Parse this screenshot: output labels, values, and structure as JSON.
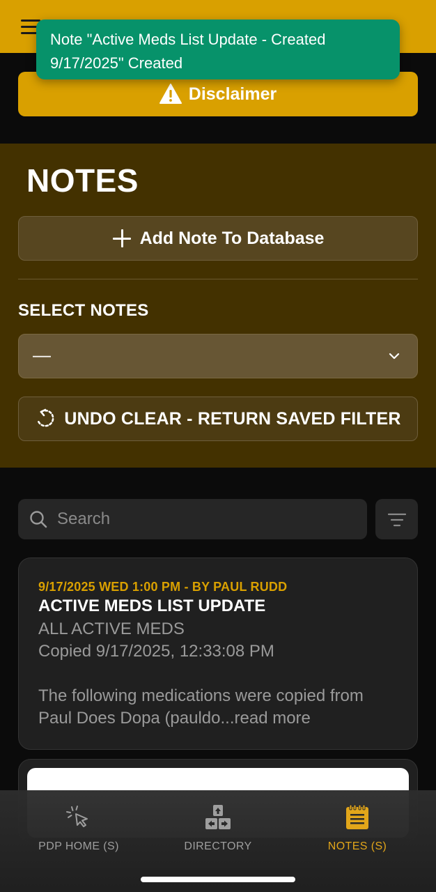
{
  "header": {
    "menu_icon": "hamburger-menu-icon",
    "toast": "Note \"Active Meds List Update - Created 9/17/2025\" Created"
  },
  "disclaimer": {
    "label": "Disclaimer",
    "icon": "warning-triangle-icon"
  },
  "notes": {
    "title": "NOTES",
    "add_button_label": "Add Note To Database",
    "select_label": "SELECT NOTES",
    "select_value": "—",
    "undo_button_label": "UNDO CLEAR - RETURN SAVED FILTER"
  },
  "search": {
    "placeholder": "Search",
    "value": ""
  },
  "note_cards": [
    {
      "meta": "9/17/2025 WED 1:00 PM - BY PAUL RUDD",
      "title": "ACTIVE MEDS LIST UPDATE",
      "subtitle": "ALL ACTIVE MEDS",
      "copied": "Copied 9/17/2025, 12:33:08 PM",
      "body": "The following medications were copied from Paul Does Dopa (pauldo...read more"
    }
  ],
  "bottom_nav": {
    "items": [
      {
        "label": "PDP HOME (S)",
        "icon": "cursor-click-icon",
        "active": false
      },
      {
        "label": "DIRECTORY",
        "icon": "arrow-keys-icon",
        "active": false
      },
      {
        "label": "NOTES (S)",
        "icon": "notepad-icon",
        "active": true
      }
    ]
  },
  "colors": {
    "accent": "#d9a000",
    "toast": "#07926a",
    "notes_panel": "#433100",
    "active_nav": "#e2a61a"
  }
}
